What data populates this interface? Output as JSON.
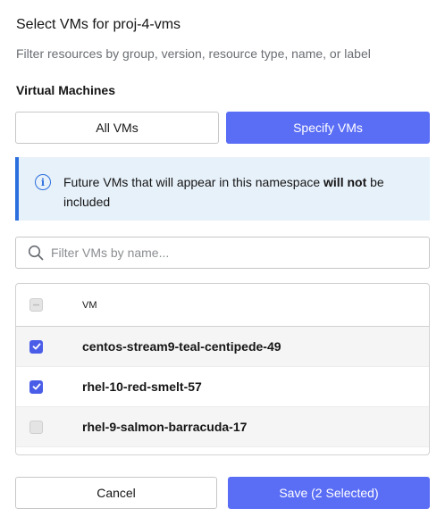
{
  "header": {
    "title": "Select VMs for proj-4-vms",
    "subtitle": "Filter resources by group, version, resource type, name, or label"
  },
  "section": {
    "label": "Virtual Machines"
  },
  "toggle": {
    "all_label": "All VMs",
    "specify_label": "Specify VMs",
    "selected": "Specify VMs"
  },
  "alert": {
    "icon": "info-icon",
    "text_before": "Future VMs that will appear in this namespace ",
    "text_bold": "will not",
    "text_after": " be included"
  },
  "search": {
    "placeholder": "Filter VMs by name...",
    "value": ""
  },
  "table": {
    "column_header": "VM",
    "header_checkbox": "indeterminate",
    "rows": [
      {
        "name": "centos-stream9-teal-centipede-49",
        "checked": true
      },
      {
        "name": "rhel-10-red-smelt-57",
        "checked": true
      },
      {
        "name": "rhel-9-salmon-barracuda-17",
        "checked": false
      }
    ]
  },
  "footer": {
    "cancel_label": "Cancel",
    "save_label": "Save (2 Selected)"
  },
  "colors": {
    "primary": "#5a6df5",
    "alert_bg": "#e7f1fa",
    "alert_border": "#2b6fde"
  }
}
